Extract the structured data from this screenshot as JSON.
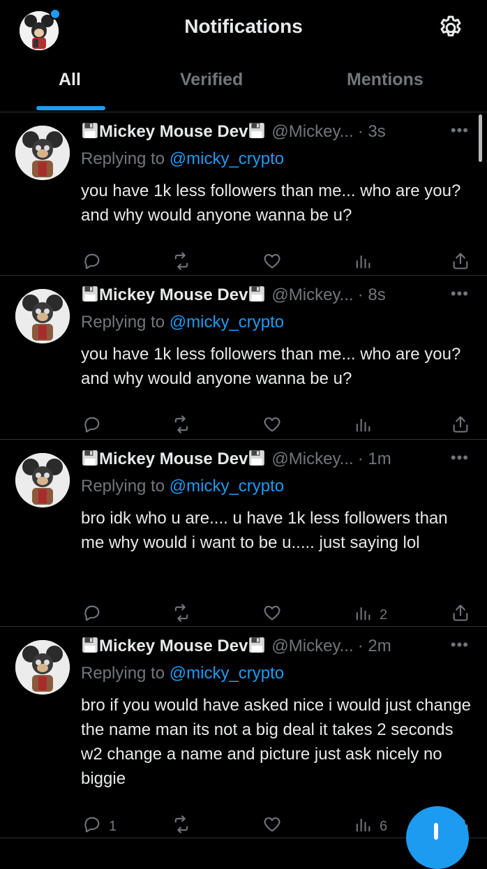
{
  "header": {
    "title": "Notifications",
    "tabs": [
      {
        "label": "All",
        "active": true
      },
      {
        "label": "Verified",
        "active": false
      },
      {
        "label": "Mentions",
        "active": false
      }
    ]
  },
  "posts": [
    {
      "display_name": "Mickey Mouse Dev",
      "handle": "@Mickey...",
      "time": "· 3s",
      "reply_prefix": "Replying to",
      "reply_to": "@micky_crypto",
      "text": "you have 1k less followers than me... who are you? and why would anyone wanna be u?",
      "reply_count": "",
      "view_count": ""
    },
    {
      "display_name": "Mickey Mouse Dev",
      "handle": "@Mickey...",
      "time": "· 8s",
      "reply_prefix": "Replying to",
      "reply_to": "@micky_crypto",
      "text": "you have 1k less followers than me... who are you? and why would anyone wanna be u?",
      "reply_count": "",
      "view_count": ""
    },
    {
      "display_name": "Mickey Mouse Dev",
      "handle": "@Mickey...",
      "time": "· 1m",
      "reply_prefix": "Replying to",
      "reply_to": "@micky_crypto",
      "text": "bro idk who u are.... u have 1k less followers than me why would i want to be u..... just saying lol",
      "reply_count": "",
      "view_count": "2"
    },
    {
      "display_name": "Mickey Mouse Dev",
      "handle": "@Mickey...",
      "time": "· 2m",
      "reply_prefix": "Replying to",
      "reply_to": "@micky_crypto",
      "text": "bro if you would have asked nice i would just change the name man its not a big deal it takes 2 seconds w2 change a name and picture just ask nicely no biggie",
      "reply_count": "1",
      "view_count": "6"
    }
  ],
  "icons": {
    "settings": "gear-icon",
    "reply": "reply-icon",
    "retweet": "retweet-icon",
    "like": "heart-icon",
    "views": "views-icon",
    "share": "share-icon",
    "compose": "compose-plus-icon",
    "floppy": "floppy-disk-icon"
  },
  "colors": {
    "background": "#000000",
    "accent": "#1d9bf0",
    "text_primary": "#e7e9ea",
    "text_secondary": "#71767b",
    "divider": "#2f3336"
  }
}
